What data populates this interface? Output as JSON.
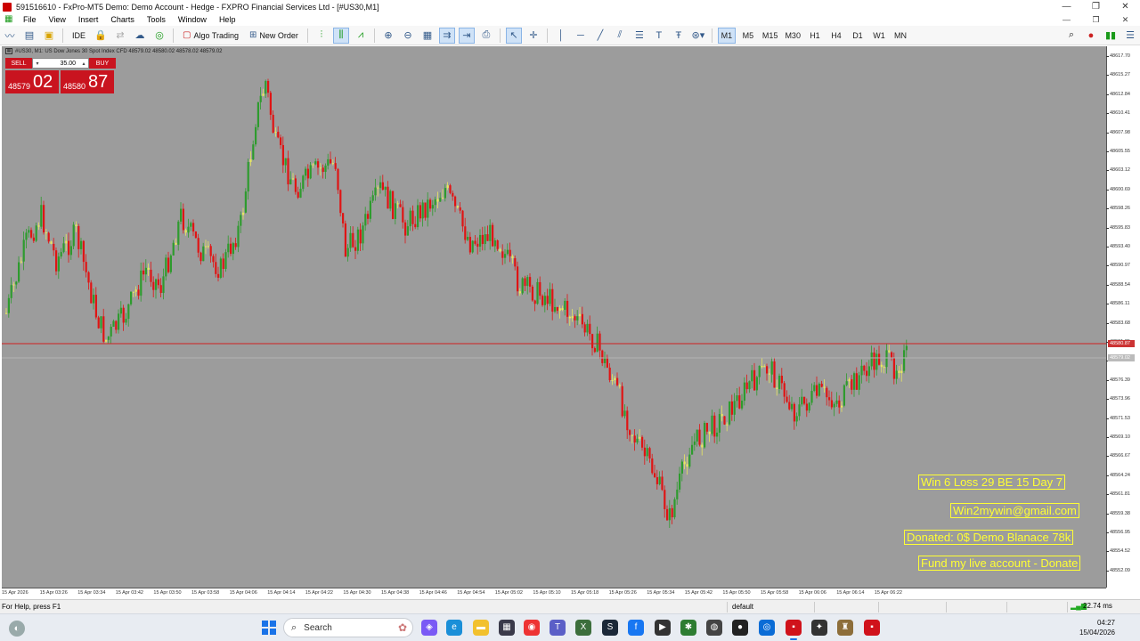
{
  "window": {
    "title": "591516610 - FxPro-MT5 Demo: Demo Account - Hedge - FXPRO Financial Services Ltd - [#US30,M1]",
    "controls": [
      "—",
      "❐",
      "✕"
    ]
  },
  "menu": {
    "items": [
      "File",
      "View",
      "Insert",
      "Charts",
      "Tools",
      "Window",
      "Help"
    ],
    "right_controls": [
      "—",
      "❐",
      "✕"
    ]
  },
  "toolbar": {
    "ide_label": "IDE",
    "algo_trading_label": "Algo Trading",
    "new_order_label": "New Order",
    "timeframes": [
      "M1",
      "M5",
      "M15",
      "M30",
      "H1",
      "H4",
      "D1",
      "W1",
      "MN"
    ],
    "active_timeframe": "M1"
  },
  "chart": {
    "info_line": "#US30, M1:  US Dow Jones 30 Spot Index CFD  48579.02 48580.02 48578.02 48579.02",
    "symbol": "#US30",
    "timeframe": "M1",
    "one_click": {
      "sell_label": "SELL",
      "buy_label": "BUY",
      "volume": "35.00",
      "sell_price_small": "48579",
      "sell_price_big": "02",
      "buy_price_small": "48580",
      "buy_price_big": "87"
    },
    "bid_line_label": "48580.87",
    "ask_line_label": "48579.02",
    "price_ticks": [
      "48617.70",
      "48615.27",
      "48612.84",
      "48610.41",
      "48607.98",
      "48605.55",
      "48603.12",
      "48600.69",
      "48598.26",
      "48595.83",
      "48593.40",
      "48590.97",
      "48588.54",
      "48586.11",
      "48583.68",
      "48581.25",
      "48578.82",
      "48576.39",
      "48573.96",
      "48571.53",
      "48569.10",
      "48566.67",
      "48564.24",
      "48561.81",
      "48559.38",
      "48556.95",
      "48554.52",
      "48552.09"
    ],
    "time_ticks": [
      "15 Apr 2026",
      "15 Apr 03:26",
      "15 Apr 03:34",
      "15 Apr 03:42",
      "15 Apr 03:50",
      "15 Apr 03:58",
      "15 Apr 04:06",
      "15 Apr 04:14",
      "15 Apr 04:22",
      "15 Apr 04:30",
      "15 Apr 04:38",
      "15 Apr 04:46",
      "15 Apr 04:54",
      "15 Apr 05:02",
      "15 Apr 05:10",
      "15 Apr 05:18",
      "15 Apr 05:26",
      "15 Apr 05:34",
      "15 Apr 05:42",
      "15 Apr 05:50",
      "15 Apr 05:58",
      "15 Apr 06:06",
      "15 Apr 06:14",
      "15 Apr 06:22"
    ],
    "notes": [
      "Win 6  Loss 29  BE 15  Day 7",
      "Win2mywin@gmail.com",
      "Donated: 0$  Demo Blanace 78k",
      "Fund my live account - Donate"
    ],
    "colors": {
      "background": "#9c9c9c",
      "bull_candle": "#2e9b2e",
      "bear_candle": "#e01414",
      "doji": "#e8e860",
      "bid_line": "#d02020",
      "note_text": "#ffff33"
    }
  },
  "status": {
    "help": "For Help, press F1",
    "profile": "default",
    "ping": "22.74 ms"
  },
  "taskbar": {
    "search_placeholder": "Search",
    "time": "04:27",
    "date": "15/04/2026"
  }
}
